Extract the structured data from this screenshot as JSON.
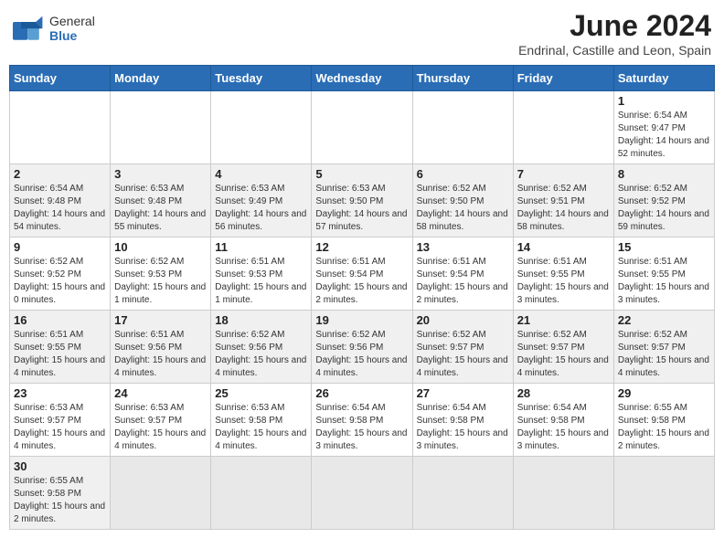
{
  "header": {
    "logo_text_normal": "General",
    "logo_text_blue": "Blue",
    "month_year": "June 2024",
    "location": "Endrinal, Castille and Leon, Spain"
  },
  "days_of_week": [
    "Sunday",
    "Monday",
    "Tuesday",
    "Wednesday",
    "Thursday",
    "Friday",
    "Saturday"
  ],
  "weeks": [
    [
      {
        "day": null,
        "info": null
      },
      {
        "day": null,
        "info": null
      },
      {
        "day": null,
        "info": null
      },
      {
        "day": null,
        "info": null
      },
      {
        "day": null,
        "info": null
      },
      {
        "day": null,
        "info": null
      },
      {
        "day": "1",
        "info": "Sunrise: 6:54 AM\nSunset: 9:47 PM\nDaylight: 14 hours and 52 minutes."
      }
    ],
    [
      {
        "day": "2",
        "info": "Sunrise: 6:54 AM\nSunset: 9:48 PM\nDaylight: 14 hours and 54 minutes."
      },
      {
        "day": "3",
        "info": "Sunrise: 6:53 AM\nSunset: 9:48 PM\nDaylight: 14 hours and 55 minutes."
      },
      {
        "day": "4",
        "info": "Sunrise: 6:53 AM\nSunset: 9:49 PM\nDaylight: 14 hours and 56 minutes."
      },
      {
        "day": "5",
        "info": "Sunrise: 6:53 AM\nSunset: 9:50 PM\nDaylight: 14 hours and 57 minutes."
      },
      {
        "day": "6",
        "info": "Sunrise: 6:52 AM\nSunset: 9:50 PM\nDaylight: 14 hours and 58 minutes."
      },
      {
        "day": "7",
        "info": "Sunrise: 6:52 AM\nSunset: 9:51 PM\nDaylight: 14 hours and 58 minutes."
      },
      {
        "day": "8",
        "info": "Sunrise: 6:52 AM\nSunset: 9:52 PM\nDaylight: 14 hours and 59 minutes."
      }
    ],
    [
      {
        "day": "9",
        "info": "Sunrise: 6:52 AM\nSunset: 9:52 PM\nDaylight: 15 hours and 0 minutes."
      },
      {
        "day": "10",
        "info": "Sunrise: 6:52 AM\nSunset: 9:53 PM\nDaylight: 15 hours and 1 minute."
      },
      {
        "day": "11",
        "info": "Sunrise: 6:51 AM\nSunset: 9:53 PM\nDaylight: 15 hours and 1 minute."
      },
      {
        "day": "12",
        "info": "Sunrise: 6:51 AM\nSunset: 9:54 PM\nDaylight: 15 hours and 2 minutes."
      },
      {
        "day": "13",
        "info": "Sunrise: 6:51 AM\nSunset: 9:54 PM\nDaylight: 15 hours and 2 minutes."
      },
      {
        "day": "14",
        "info": "Sunrise: 6:51 AM\nSunset: 9:55 PM\nDaylight: 15 hours and 3 minutes."
      },
      {
        "day": "15",
        "info": "Sunrise: 6:51 AM\nSunset: 9:55 PM\nDaylight: 15 hours and 3 minutes."
      }
    ],
    [
      {
        "day": "16",
        "info": "Sunrise: 6:51 AM\nSunset: 9:55 PM\nDaylight: 15 hours and 4 minutes."
      },
      {
        "day": "17",
        "info": "Sunrise: 6:51 AM\nSunset: 9:56 PM\nDaylight: 15 hours and 4 minutes."
      },
      {
        "day": "18",
        "info": "Sunrise: 6:52 AM\nSunset: 9:56 PM\nDaylight: 15 hours and 4 minutes."
      },
      {
        "day": "19",
        "info": "Sunrise: 6:52 AM\nSunset: 9:56 PM\nDaylight: 15 hours and 4 minutes."
      },
      {
        "day": "20",
        "info": "Sunrise: 6:52 AM\nSunset: 9:57 PM\nDaylight: 15 hours and 4 minutes."
      },
      {
        "day": "21",
        "info": "Sunrise: 6:52 AM\nSunset: 9:57 PM\nDaylight: 15 hours and 4 minutes."
      },
      {
        "day": "22",
        "info": "Sunrise: 6:52 AM\nSunset: 9:57 PM\nDaylight: 15 hours and 4 minutes."
      }
    ],
    [
      {
        "day": "23",
        "info": "Sunrise: 6:53 AM\nSunset: 9:57 PM\nDaylight: 15 hours and 4 minutes."
      },
      {
        "day": "24",
        "info": "Sunrise: 6:53 AM\nSunset: 9:57 PM\nDaylight: 15 hours and 4 minutes."
      },
      {
        "day": "25",
        "info": "Sunrise: 6:53 AM\nSunset: 9:58 PM\nDaylight: 15 hours and 4 minutes."
      },
      {
        "day": "26",
        "info": "Sunrise: 6:54 AM\nSunset: 9:58 PM\nDaylight: 15 hours and 3 minutes."
      },
      {
        "day": "27",
        "info": "Sunrise: 6:54 AM\nSunset: 9:58 PM\nDaylight: 15 hours and 3 minutes."
      },
      {
        "day": "28",
        "info": "Sunrise: 6:54 AM\nSunset: 9:58 PM\nDaylight: 15 hours and 3 minutes."
      },
      {
        "day": "29",
        "info": "Sunrise: 6:55 AM\nSunset: 9:58 PM\nDaylight: 15 hours and 2 minutes."
      }
    ],
    [
      {
        "day": "30",
        "info": "Sunrise: 6:55 AM\nSunset: 9:58 PM\nDaylight: 15 hours and 2 minutes."
      },
      {
        "day": null,
        "info": null
      },
      {
        "day": null,
        "info": null
      },
      {
        "day": null,
        "info": null
      },
      {
        "day": null,
        "info": null
      },
      {
        "day": null,
        "info": null
      },
      {
        "day": null,
        "info": null
      }
    ]
  ]
}
